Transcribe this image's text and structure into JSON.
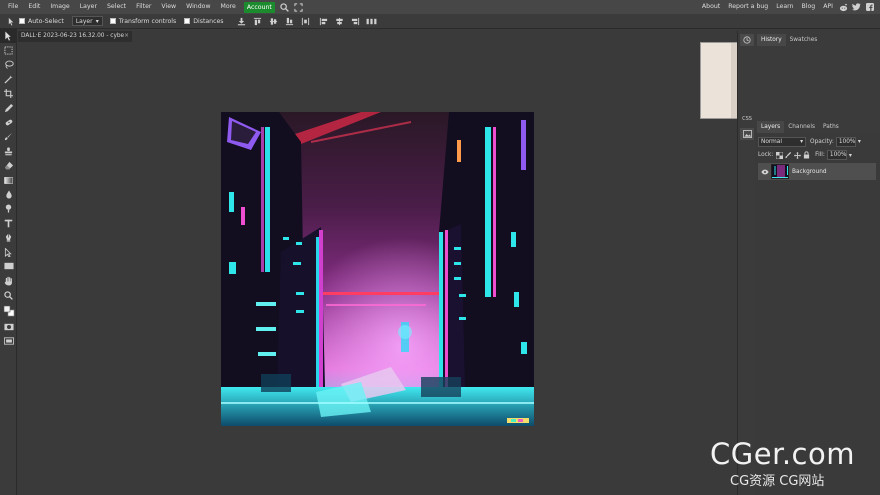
{
  "menu": {
    "items": [
      "File",
      "Edit",
      "Image",
      "Layer",
      "Select",
      "Filter",
      "View",
      "Window",
      "More"
    ],
    "account": "Account",
    "right_links": [
      "About",
      "Report a bug",
      "Learn",
      "Blog",
      "API"
    ],
    "accent_color": "#1c8b2e"
  },
  "options": {
    "auto_select": "Auto-Select",
    "layer_select": "Layer",
    "transform_controls": "Transform controls",
    "distances": "Distances"
  },
  "document": {
    "tab_title": "DALL·E 2023-06-23 16.32.00 - cybe",
    "close": "×"
  },
  "side_strip": {
    "css_label": "CSS"
  },
  "panels": {
    "top_tabs": [
      "History",
      "Swatches"
    ],
    "layer_tabs": [
      "Layers",
      "Channels",
      "Paths"
    ],
    "blend_mode": "Normal",
    "opacity_label": "Opacity:",
    "opacity_value": "100%",
    "lock_label": "Lock:",
    "fill_label": "Fill:",
    "fill_value": "100%",
    "layer_name": "Background"
  },
  "watermark": {
    "main": "CGer.com",
    "sub": "CG资源 CG网站"
  }
}
